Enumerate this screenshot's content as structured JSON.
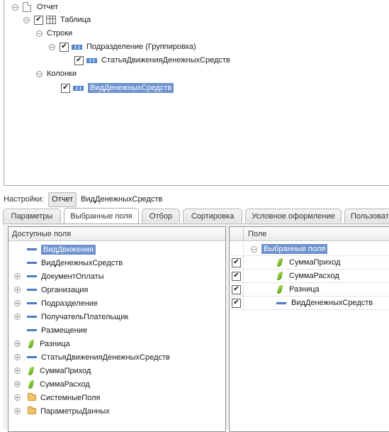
{
  "structure": {
    "items": [
      {
        "label": "Отчет",
        "toggle": "⊖",
        "checked": false,
        "icon": "report-doc-icon"
      },
      {
        "label": "Таблица",
        "toggle": "⊖",
        "checked": true,
        "icon": "table-icon"
      },
      {
        "label": "Строки",
        "toggle": "⊖",
        "checked": false,
        "icon": ""
      },
      {
        "label": "Подразделение (Группировка)",
        "toggle": "⊖",
        "checked": true,
        "icon": "grouping-icon"
      },
      {
        "label": "СтатьяДвиженияДенежныхСредств",
        "toggle": "",
        "checked": true,
        "icon": "grouping-icon"
      },
      {
        "label": "Колонки",
        "toggle": "⊖",
        "checked": false,
        "icon": ""
      },
      {
        "label": "ВидДенежныхСредств",
        "toggle": "",
        "checked": true,
        "icon": "grouping-icon",
        "selected": true
      }
    ]
  },
  "settings": {
    "label": "Настройки:",
    "scope_button": "Отчет",
    "current": "ВидДенежныхСредств"
  },
  "tabs": [
    {
      "label": "Параметры",
      "active": false
    },
    {
      "label": "Выбранные поля",
      "active": true
    },
    {
      "label": "Отбор",
      "active": false
    },
    {
      "label": "Сортировка",
      "active": false
    },
    {
      "label": "Условное оформление",
      "active": false
    },
    {
      "label": "Пользоват",
      "active": false
    }
  ],
  "available_fields": {
    "header": "Доступные поля",
    "items": [
      {
        "label": "ВидДвижения",
        "expandable": false,
        "icon": "field-icon",
        "selected": true
      },
      {
        "label": "ВидДенежныхСредств",
        "expandable": false,
        "icon": "field-icon"
      },
      {
        "label": "ДокументОплаты",
        "expandable": true,
        "icon": "field-icon"
      },
      {
        "label": "Организация",
        "expandable": true,
        "icon": "field-icon"
      },
      {
        "label": "Подразделение",
        "expandable": true,
        "icon": "field-icon"
      },
      {
        "label": "ПолучательПлательщик",
        "expandable": true,
        "icon": "field-icon"
      },
      {
        "label": "Размещение",
        "expandable": false,
        "icon": "field-icon"
      },
      {
        "label": "Разница",
        "expandable": true,
        "icon": "resource-icon"
      },
      {
        "label": "СтатьяДвиженияДенежныхСредств",
        "expandable": true,
        "icon": "field-icon"
      },
      {
        "label": "СуммаПриход",
        "expandable": true,
        "icon": "resource-icon"
      },
      {
        "label": "СуммаРасход",
        "expandable": true,
        "icon": "resource-icon"
      },
      {
        "label": "СистемныеПоля",
        "expandable": true,
        "icon": "folder-icon"
      },
      {
        "label": "ПараметрыДанных",
        "expandable": true,
        "icon": "folder-icon"
      }
    ]
  },
  "selected_fields": {
    "header": "Поле",
    "group_label": "Выбранные поля",
    "items": [
      {
        "label": "СуммаПриход",
        "checked": true,
        "icon": "resource-icon"
      },
      {
        "label": "СуммаРасход",
        "checked": true,
        "icon": "resource-icon"
      },
      {
        "label": "Разница",
        "checked": true,
        "icon": "resource-icon"
      },
      {
        "label": "ВидДенежныхСредств",
        "checked": true,
        "icon": "field-icon"
      }
    ]
  },
  "colors": {
    "selection": "#6e92cf",
    "field_icon": "#5b8fd6",
    "resource_icon": "#4f9b15",
    "folder_icon": "#f1c46b"
  }
}
